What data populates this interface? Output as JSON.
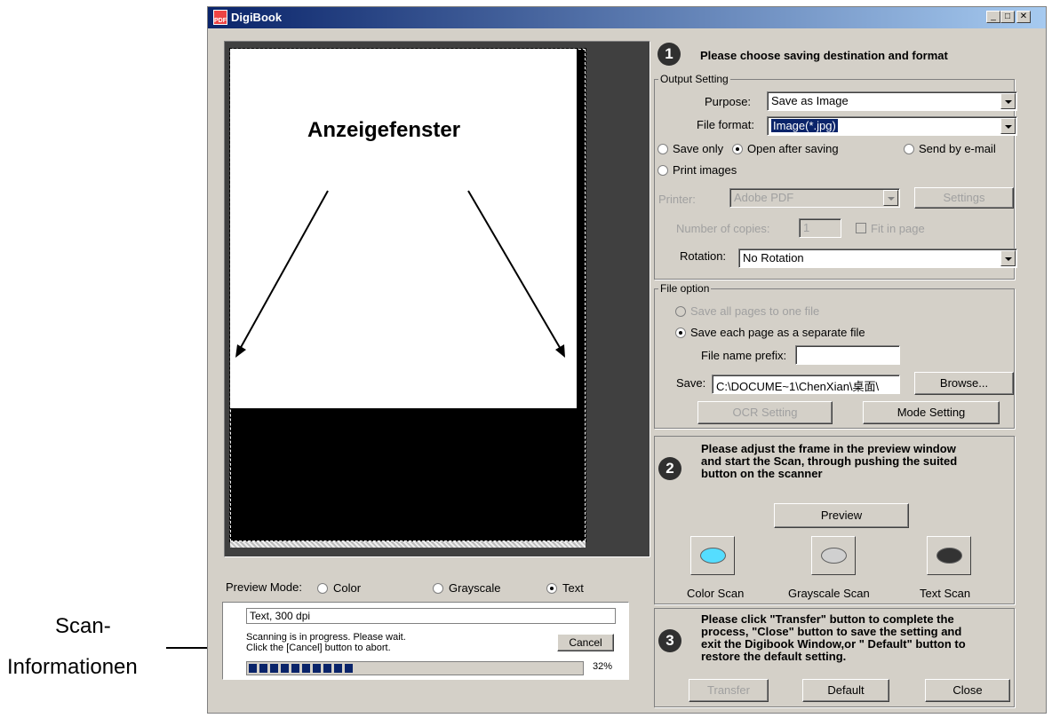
{
  "annotations": {
    "viewer_label": "Anzeigefenster",
    "scan_info_label_line1": "Scan-",
    "scan_info_label_line2": "Informationen"
  },
  "window": {
    "title": "DigiBook",
    "controls": {
      "minimize": "_",
      "maximize": "□",
      "close": "✕"
    }
  },
  "preview": {
    "mode_label": "Preview Mode:",
    "modes": [
      {
        "label": "Color",
        "selected": false
      },
      {
        "label": "Grayscale",
        "selected": false
      },
      {
        "label": "Text",
        "selected": true
      }
    ]
  },
  "status": {
    "info": "Text,  300 dpi",
    "line1": "Scanning is in progress.  Please wait.",
    "line2": "Click the [Cancel] button to abort.",
    "cancel_label": "Cancel",
    "progress_percent": 32,
    "progress_text": "32%"
  },
  "step1": {
    "number": "1",
    "heading": "Please choose saving destination and format",
    "output_setting": {
      "group_label": "Output Setting",
      "purpose_label": "Purpose:",
      "purpose_value": "Save as Image",
      "file_format_label": "File format:",
      "file_format_value": "Image(*.jpg)",
      "save_options": [
        {
          "label": "Save only",
          "selected": false
        },
        {
          "label": "Open after saving",
          "selected": true
        },
        {
          "label": "Send by e-mail",
          "selected": false
        },
        {
          "label": "Print images",
          "selected": false
        }
      ],
      "printer_label": "Printer:",
      "printer_value": "Adobe PDF",
      "settings_label": "Settings",
      "copies_label": "Number of copies:",
      "copies_value": "1",
      "fit_label": "Fit in page",
      "rotation_label": "Rotation:",
      "rotation_value": "No Rotation"
    },
    "file_option": {
      "group_label": "File option",
      "all_pages_label": "Save all pages to one file",
      "separate_label": "Save each page as a separate file",
      "prefix_label": "File name prefix:",
      "prefix_value": "",
      "save_label": "Save:",
      "save_path": "C:\\DOCUME~1\\ChenXian\\桌面\\",
      "browse_label": "Browse...",
      "ocr_label": "OCR Setting",
      "mode_label": "Mode Setting"
    }
  },
  "step2": {
    "number": "2",
    "heading_line1": "Please adjust the frame in the preview window",
    "heading_line2": "and start the Scan, through pushing the suited",
    "heading_line3": "button on the scanner",
    "preview_label": "Preview",
    "scan_buttons": [
      {
        "label": "Color Scan",
        "color": "#55ddff"
      },
      {
        "label": "Grayscale Scan",
        "color": "#d0d0d0"
      },
      {
        "label": "Text Scan",
        "color": "#333333"
      }
    ]
  },
  "step3": {
    "number": "3",
    "heading_line1": "Please click \"Transfer\" button to complete the",
    "heading_line2": "process, \"Close\" button to save the setting and",
    "heading_line3": "exit the Digibook Window,or \" Default\" button to",
    "heading_line4": "restore the default setting.",
    "transfer_label": "Transfer",
    "default_label": "Default",
    "close_label": "Close"
  }
}
